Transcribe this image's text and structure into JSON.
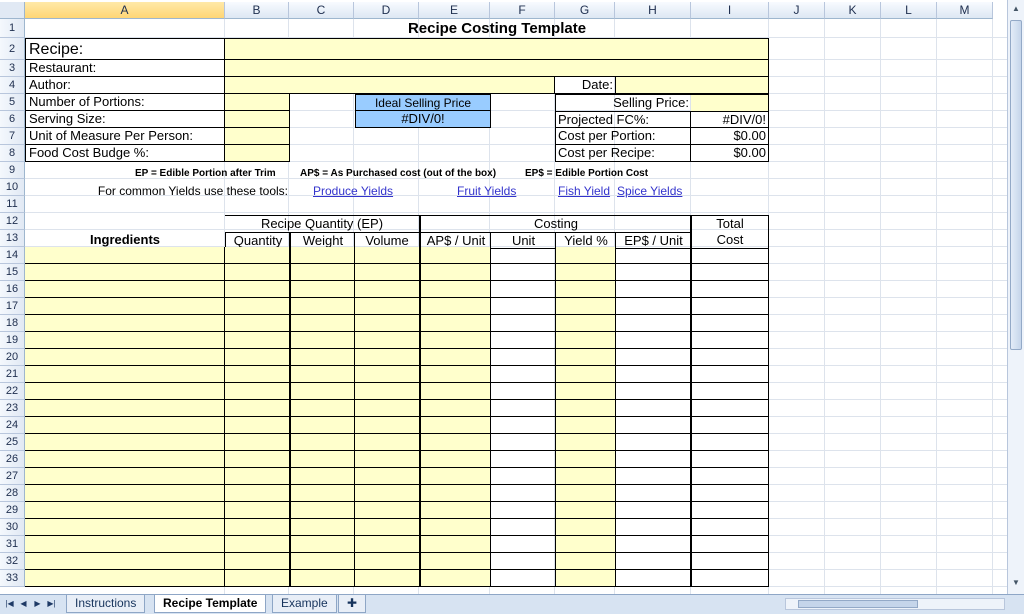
{
  "columns": [
    "A",
    "B",
    "C",
    "D",
    "E",
    "F",
    "G",
    "H",
    "I",
    "J",
    "K",
    "L",
    "M"
  ],
  "rows": [
    "1",
    "2",
    "3",
    "4",
    "5",
    "6",
    "7",
    "8",
    "9",
    "10",
    "11",
    "12",
    "13",
    "14",
    "15",
    "16",
    "17",
    "18",
    "19",
    "20",
    "21",
    "22",
    "23",
    "24",
    "25",
    "26",
    "27",
    "28",
    "29",
    "30",
    "31",
    "32",
    "33"
  ],
  "sheet": {
    "title": "Recipe Costing Template",
    "recipe_label": "Recipe:",
    "restaurant_label": "Restaurant:",
    "author_label": "Author:",
    "date_label": "Date:",
    "portions_label": "Number of Portions:",
    "serving_label": "Serving Size:",
    "uom_label": "Unit of Measure Per Person:",
    "budget_label": "Food Cost Budge %:",
    "ideal_price_label": "Ideal Selling Price",
    "ideal_price_value": "#DIV/0!",
    "selling_price_label": "Selling Price:",
    "projected_fc_label": "Projected FC%:",
    "projected_fc_value": "#DIV/0!",
    "cost_portion_label": "Cost per Portion:",
    "cost_portion_value": "$0.00",
    "cost_recipe_label": "Cost per Recipe:",
    "cost_recipe_value": "$0.00",
    "note_ep": "EP = Edible Portion after Trim",
    "note_ap": "AP$ = As Purchased cost (out of the box)",
    "note_eps": "EP$ = Edible Portion Cost",
    "yield_tools_label": "For common Yields use these tools:",
    "links": {
      "produce": "Produce Yields",
      "fruit": "Fruit Yields",
      "fish": "Fish Yield",
      "spice": "Spice Yields"
    },
    "header_group_qty": "Recipe Quantity (EP)",
    "header_group_costing": "Costing",
    "header_total": "Total",
    "header_cost": "Cost",
    "header_ingredients": "Ingredients",
    "header_quantity": "Quantity",
    "header_weight": "Weight",
    "header_volume": "Volume",
    "header_ap_unit": "AP$ / Unit",
    "header_unit": "Unit",
    "header_yield": "Yield %",
    "header_ep_unit": "EP$ / Unit"
  },
  "tabs": [
    "Instructions",
    "Recipe Template",
    "Example"
  ]
}
